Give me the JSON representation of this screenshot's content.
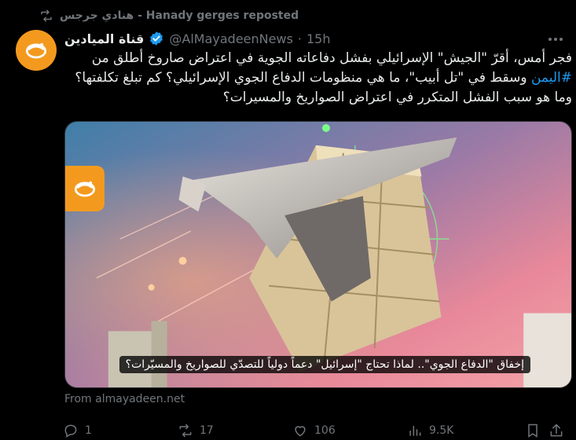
{
  "repost": {
    "text": "هنادي جرجس - Hanady gerges reposted",
    "icon": "repost-icon"
  },
  "post": {
    "display_name": "قناة الميادين",
    "handle": "@AlMayadeenNews",
    "separator": "·",
    "time": "15h",
    "text_parts": {
      "line1": "فجر أمس، أقرّ \"الجيش\" الإسرائيلي بفشل دفاعاته الجوية في اعتراض صاروخ أطلق من",
      "hashtag": "#اليمن",
      "line2": " وسقط في \"تل أبيب\"، ما هي منظومات الدفاع الجوي الإسرائيلي؟ كم تبلغ تكلفتها؟ وما هو سبب الفشل المتكرر في اعتراض الصواريخ والمسيرات؟"
    },
    "media_caption": "إخفاق \"الدفاع الجوي\".. لماذا تحتاج \"إسرائيل\" دعماً دولياً للتصدّي للصواريخ والمسيّرات؟",
    "source": "From almayadeen.net"
  },
  "actions": {
    "reply_count": "1",
    "repost_count": "17",
    "like_count": "106",
    "views_count": "9.5K"
  },
  "colors": {
    "background": "#000000",
    "text": "#e7e9ea",
    "muted": "#71767b",
    "accent": "#1d9bf0",
    "brand_orange": "#f39a1e"
  }
}
